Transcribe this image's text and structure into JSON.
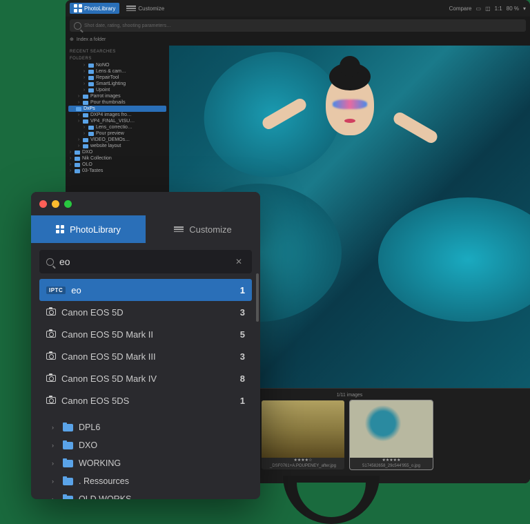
{
  "monitor": {
    "toolbar": {
      "tab_library": "PhotoLibrary",
      "tab_customize": "Customize",
      "compare": "Compare",
      "zoom": "1:1",
      "percent": "80 %"
    },
    "searchbar": {
      "placeholder": "Shot date, rating, shooting parameters…"
    },
    "index_folder": "Index a folder",
    "sidebar": {
      "recent_label": "RECENT SEARCHES",
      "folders_label": "FOLDERS",
      "tree": [
        {
          "label": "NoNO",
          "indent": 2
        },
        {
          "label": "Lens & cam…",
          "indent": 2
        },
        {
          "label": "RepairTool",
          "indent": 2
        },
        {
          "label": "SmartLighting",
          "indent": 2
        },
        {
          "label": "Upoint",
          "indent": 2
        },
        {
          "label": "Parrot images",
          "indent": 1
        },
        {
          "label": "Pour thumbnails",
          "indent": 1
        },
        {
          "label": "DxPs",
          "indent": 0,
          "sel": true
        },
        {
          "label": "DXP4 images fro…",
          "indent": 1
        },
        {
          "label": "VP4_FINAL_VISU…",
          "indent": 1
        },
        {
          "label": "Lens_correctio…",
          "indent": 2
        },
        {
          "label": "Pour preview",
          "indent": 2
        },
        {
          "label": "VIDEO_DEMOs…",
          "indent": 1
        },
        {
          "label": "website layout",
          "indent": 1
        },
        {
          "label": "DXO",
          "indent": 0
        },
        {
          "label": "Nik Collection",
          "indent": 0
        },
        {
          "label": "OLO",
          "indent": 0
        },
        {
          "label": "03-Tastes",
          "indent": 0
        }
      ]
    },
    "strip": {
      "counter": "1/11 images",
      "thumbs": [
        {
          "caption": "",
          "rating": ""
        },
        {
          "caption": "_DSF0761+A.POUPENEY_after.jpg",
          "rating": "★★★★☆"
        },
        {
          "caption": "5174582658_29c544'955_o.jpg",
          "rating": "★★★★★"
        }
      ]
    }
  },
  "panel": {
    "tabs": {
      "library": "PhotoLibrary",
      "customize": "Customize"
    },
    "search": {
      "value": "eo"
    },
    "results": [
      {
        "type": "iptc",
        "label": "eo",
        "count": "1",
        "active": true
      },
      {
        "type": "cam",
        "label": "Canon EOS 5D",
        "count": "3"
      },
      {
        "type": "cam",
        "label": "Canon EOS 5D Mark II",
        "count": "5"
      },
      {
        "type": "cam",
        "label": "Canon EOS 5D Mark III",
        "count": "3"
      },
      {
        "type": "cam",
        "label": "Canon EOS 5D Mark IV",
        "count": "8"
      },
      {
        "type": "cam",
        "label": "Canon EOS 5DS",
        "count": "1"
      }
    ],
    "iptc_badge": "IPTC",
    "folders": [
      {
        "label": "DPL6"
      },
      {
        "label": "DXO"
      },
      {
        "label": "WORKING"
      },
      {
        "label": ". Ressources"
      },
      {
        "label": "OLD WORKS"
      }
    ]
  }
}
